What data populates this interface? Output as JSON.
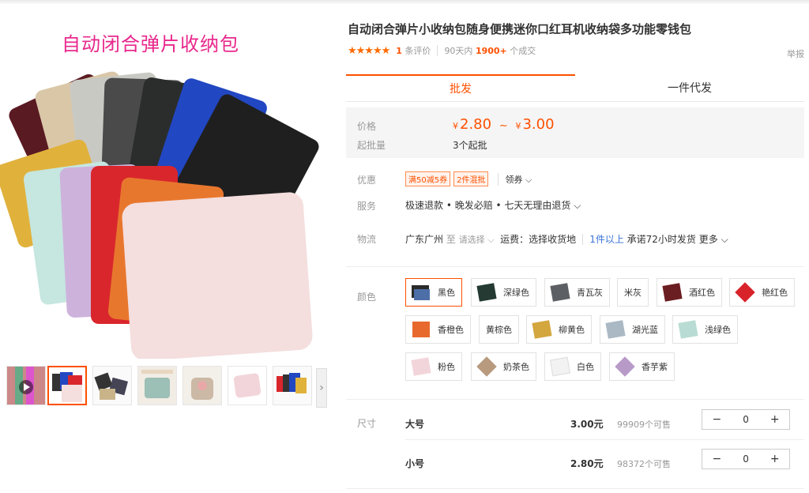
{
  "gallery": {
    "main_image_title": "自动闭合弹片收纳包",
    "thumbnails": [
      {
        "name": "video-thumb"
      },
      {
        "name": "color-fan-thumb"
      },
      {
        "name": "dark-pouches-thumb"
      },
      {
        "name": "detail-thumb-1"
      },
      {
        "name": "detail-thumb-2"
      },
      {
        "name": "pink-pouch-thumb"
      },
      {
        "name": "color-set-thumb"
      }
    ]
  },
  "product": {
    "title": "自动闭合弹片小收纳包随身便携迷你口红耳机收纳袋多功能零钱包",
    "stars": "★★★★★",
    "review_count": "1",
    "review_label": "条评价",
    "sold_period": "90天内",
    "sold_count": "1900+",
    "sold_label": "个成交",
    "report_label": "举报"
  },
  "tabs": {
    "wholesale": "批发",
    "dropship": "一件代发"
  },
  "pricing": {
    "price_label": "价格",
    "currency": "¥",
    "price_low": "2.80",
    "price_sep": "~",
    "price_high": "3.00",
    "moq_label": "起批量",
    "moq_value": "3个起批"
  },
  "promo": {
    "label": "优惠",
    "tag1": "满50减5券",
    "tag2": "2件混批",
    "coupon": "领券 ⌵"
  },
  "service": {
    "label": "服务",
    "value": "极速退款 • 晚发必赔 • 七天无理由退货 ⌵"
  },
  "logistics": {
    "label": "物流",
    "from": "广东广州",
    "to_word": "至",
    "to_placeholder": "请选择 ⌵",
    "freight": "运费：选择收货地",
    "qty": "1件以上",
    "promise": "承诺72小时发货",
    "more": "更多 ⌵"
  },
  "colors": {
    "label": "颜色",
    "options": [
      {
        "name": "黑色",
        "chip": "#2b2b2b",
        "selected": true
      },
      {
        "name": "深绿色",
        "chip": "#243a33"
      },
      {
        "name": "青瓦灰",
        "chip": "#5c6064"
      },
      {
        "name": "米灰",
        "chip": ""
      },
      {
        "name": "酒红色",
        "chip": "#6b1e22"
      },
      {
        "name": "艳红色",
        "chip": "#d9232b"
      },
      {
        "name": "香橙色",
        "chip": "#e8692d"
      },
      {
        "name": "黄棕色",
        "chip": ""
      },
      {
        "name": "柳黄色",
        "chip": "#d4a63e"
      },
      {
        "name": "湖光蓝",
        "chip": "#aab9c4"
      },
      {
        "name": "浅绿色",
        "chip": "#b8dcd3"
      },
      {
        "name": "粉色",
        "chip": "#f2d5da"
      },
      {
        "name": "奶茶色",
        "chip": "#b89a7e"
      },
      {
        "name": "白色",
        "chip": "#f2f2f2"
      },
      {
        "name": "香芋紫",
        "chip": "#b89ac8"
      }
    ]
  },
  "sizes": {
    "label": "尺寸",
    "rows": [
      {
        "name": "大号",
        "price": "3.00元",
        "stock": "99909个可售",
        "qty": "0",
        "minus": "−",
        "plus": "+"
      },
      {
        "name": "小号",
        "price": "2.80元",
        "stock": "98372个可售",
        "qty": "0",
        "minus": "−",
        "plus": "+"
      }
    ]
  }
}
